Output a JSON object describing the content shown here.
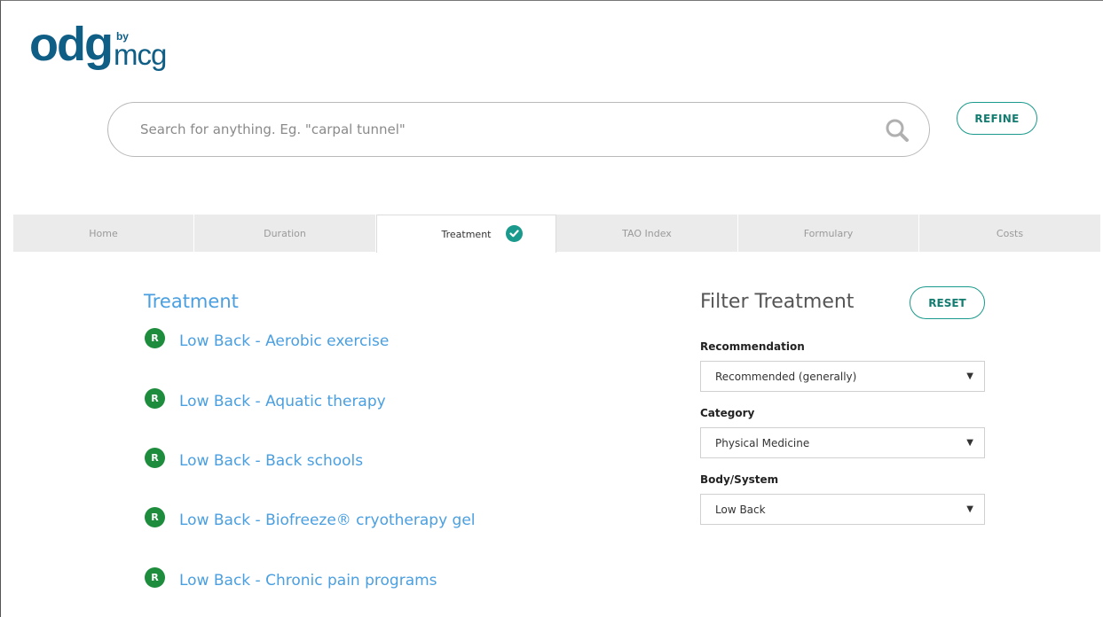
{
  "logo": {
    "main": "odg",
    "by": "by",
    "brand": "mcg"
  },
  "search": {
    "placeholder": "Search for anything. Eg. \"carpal tunnel\"",
    "icon": "search-icon"
  },
  "refine_label": "REFINE",
  "tabs": [
    {
      "label": "Home",
      "active": false
    },
    {
      "label": "Duration",
      "active": false
    },
    {
      "label": "Treatment",
      "active": true
    },
    {
      "label": "TAO Index",
      "active": false
    },
    {
      "label": "Formulary",
      "active": false
    },
    {
      "label": "Costs",
      "active": false
    }
  ],
  "treatment": {
    "title": "Treatment",
    "items": [
      {
        "badge": "R",
        "label": "Low Back - Aerobic exercise"
      },
      {
        "badge": "R",
        "label": "Low Back - Aquatic therapy"
      },
      {
        "badge": "R",
        "label": "Low Back - Back schools"
      },
      {
        "badge": "R",
        "label": "Low Back - Biofreeze® cryotherapy gel"
      },
      {
        "badge": "R",
        "label": "Low Back - Chronic pain programs"
      }
    ]
  },
  "filter": {
    "title": "Filter Treatment",
    "reset_label": "RESET",
    "fields": [
      {
        "label": "Recommendation",
        "value": "Recommended (generally)"
      },
      {
        "label": "Category",
        "value": "Physical Medicine"
      },
      {
        "label": "Body/System",
        "value": "Low Back"
      }
    ]
  },
  "colors": {
    "brand_blue": "#0f5e86",
    "accent_teal": "#1a9a8c",
    "link_blue": "#4a9fe0",
    "badge_green": "#1e8c3d"
  }
}
